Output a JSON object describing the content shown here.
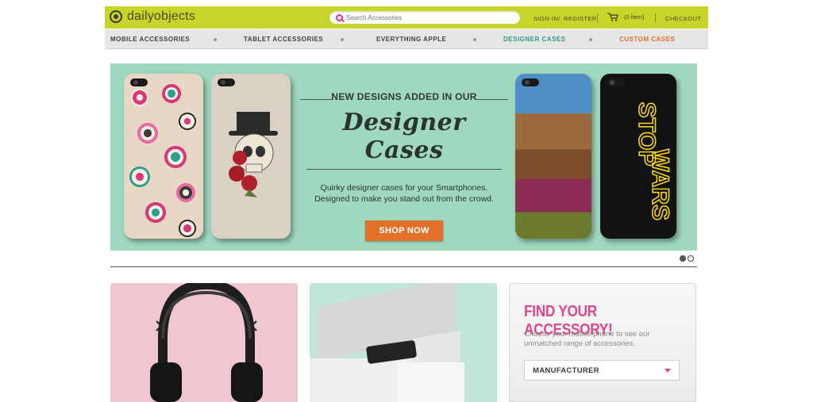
{
  "brand": {
    "name": "dailyobjects"
  },
  "header": {
    "search_placeholder": "Search Accessories",
    "signin": "SIGN-IN",
    "separator": "/",
    "register": "REGISTER",
    "cart_count": "(0 item)",
    "checkout": "CHECKOUT"
  },
  "nav": {
    "items": [
      {
        "label": "MOBILE ACCESSORIES"
      },
      {
        "label": "TABLET ACCESSORIES"
      },
      {
        "label": "EVERYTHING APPLE"
      },
      {
        "label": "DESIGNER CASES",
        "color": "#2a9a8a"
      },
      {
        "label": "CUSTOM CASES",
        "color": "#e0702a"
      }
    ]
  },
  "banner": {
    "kicker": "NEW DESIGNS ADDED IN OUR",
    "title": "Designer Cases",
    "desc_line1": "Quirky designer cases for your Smartphones.",
    "desc_line2": "Designed to make you stand out from the crowd.",
    "cta": "SHOP NOW",
    "case_text_top": "STOP",
    "case_text_bottom": "WARS",
    "slides_total": 2,
    "active_slide": 1
  },
  "finder": {
    "title": "FIND YOUR ACCESSORY!",
    "desc_line1": "Choose your mobile phone to see our",
    "desc_line2": "unmatched range of accessories.",
    "select_label": "MANUFACTURER"
  },
  "colors": {
    "accent": "#c7d52a",
    "banner_bg": "#9fd7bf",
    "cta": "#e0702a",
    "pink": "#e0478d"
  }
}
